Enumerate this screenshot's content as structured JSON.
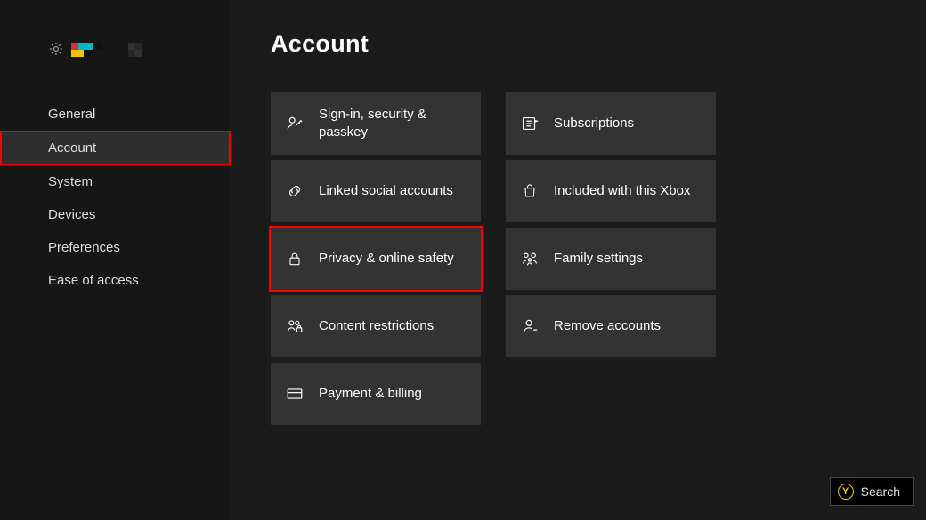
{
  "page": {
    "title": "Account"
  },
  "sidebar": {
    "items": [
      {
        "label": "General"
      },
      {
        "label": "Account"
      },
      {
        "label": "System"
      },
      {
        "label": "Devices"
      },
      {
        "label": "Preferences"
      },
      {
        "label": "Ease of access"
      }
    ],
    "selected_index": 1
  },
  "tiles": {
    "col1": [
      {
        "label": "Sign-in, security & passkey",
        "icon": "person-key-icon"
      },
      {
        "label": "Linked social accounts",
        "icon": "link-icon"
      },
      {
        "label": "Privacy & online safety",
        "icon": "lock-icon",
        "highlighted": true
      },
      {
        "label": "Content restrictions",
        "icon": "people-lock-icon"
      },
      {
        "label": "Payment & billing",
        "icon": "card-icon"
      }
    ],
    "col2": [
      {
        "label": "Subscriptions",
        "icon": "list-icon"
      },
      {
        "label": "Included with this Xbox",
        "icon": "bag-icon"
      },
      {
        "label": "Family settings",
        "icon": "family-icon"
      },
      {
        "label": "Remove accounts",
        "icon": "person-remove-icon"
      }
    ]
  },
  "footer": {
    "search_button_key": "Y",
    "search_button_label": "Search"
  }
}
